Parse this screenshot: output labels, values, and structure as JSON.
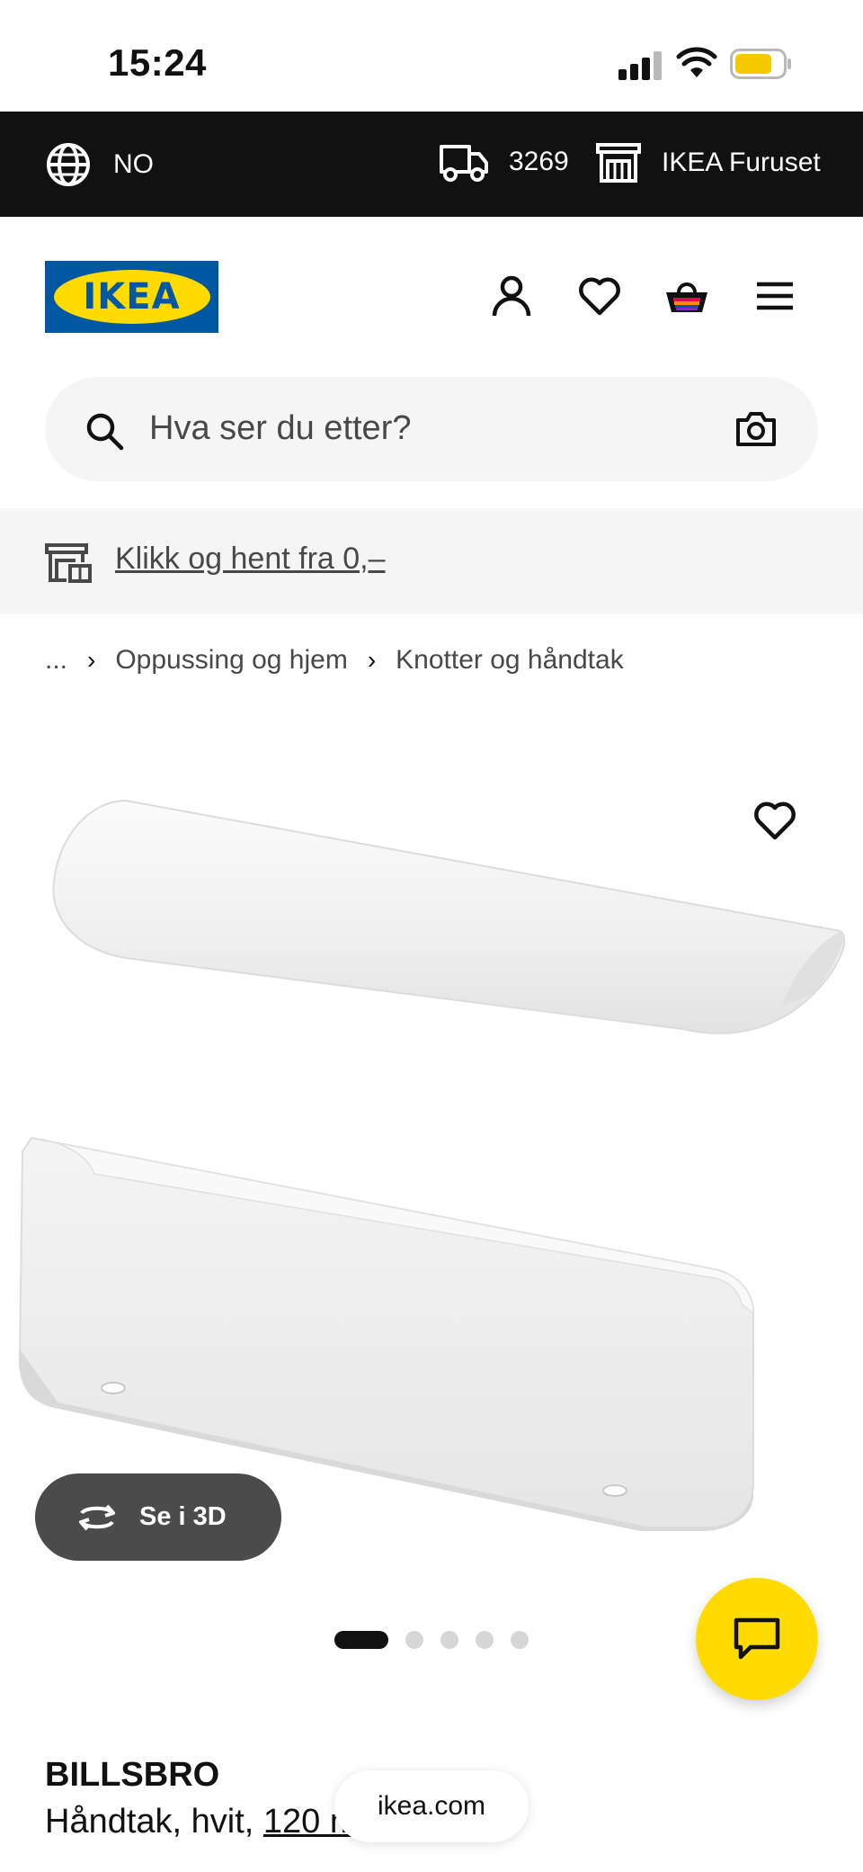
{
  "status_bar": {
    "time": "15:24"
  },
  "top_bar": {
    "language": "NO",
    "postcode": "3269",
    "store": "IKEA Furuset"
  },
  "header": {
    "logo_text": "IKEA",
    "brand_colors": {
      "blue": "#0058a3",
      "yellow": "#ffdb00"
    },
    "icons": [
      "profile-icon",
      "heart-icon",
      "basket-icon",
      "menu-icon"
    ]
  },
  "search": {
    "placeholder": "Hva ser du etter?"
  },
  "banner": {
    "text": "Klikk og hent fra 0,–"
  },
  "breadcrumb": {
    "items": [
      "...",
      "Oppussing og hjem",
      "Knotter og håndtak"
    ]
  },
  "gallery": {
    "view3d_label": "Se i 3D",
    "total_images": 5,
    "active_index": 1
  },
  "product": {
    "name": "BILLSBRO",
    "description": "Håndtak, hvit,",
    "measure": "120 mm"
  },
  "browser": {
    "url": "ikea.com"
  },
  "colors": {
    "accent": "#ffdb00",
    "dark": "#111111"
  }
}
